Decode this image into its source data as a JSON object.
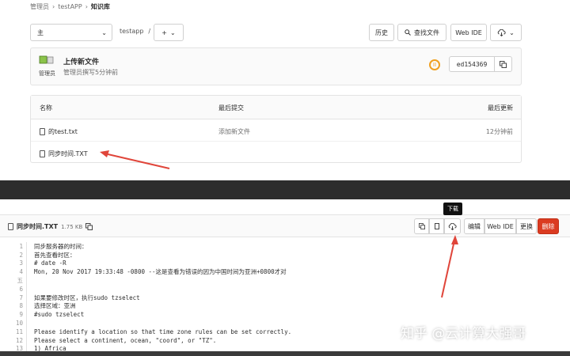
{
  "breadcrumb": [
    "管理员",
    "testAPP",
    "知识库"
  ],
  "toolbar": {
    "branch": "主",
    "path_root": "testapp",
    "path_sep": "/",
    "add_label": "+",
    "history": "历史",
    "find_file": "查找文件",
    "web_ide": "Web IDE"
  },
  "commit": {
    "avatar_text": "管理员",
    "title": "上传新文件",
    "meta": "管理员撰写5分钟前",
    "sha": "ed154369"
  },
  "files": {
    "headers": {
      "name": "名称",
      "last_commit": "最后提交",
      "last_update": "最后更新"
    },
    "rows": [
      {
        "name": "的test.txt",
        "commit": "添加新文件",
        "time": "12分钟前"
      },
      {
        "name": "同步时间.TXT",
        "commit": "",
        "time": ""
      }
    ]
  },
  "tooltip": "下载",
  "viewer": {
    "filename": "同步时间.TXT",
    "size": "1.75 KB",
    "edit": "编辑",
    "web_ide": "Web IDE",
    "replace": "更换",
    "delete": "删除",
    "lines": [
      {
        "n": "1",
        "t": "同步服务器的时间："
      },
      {
        "n": "2",
        "t": "首先查看时区："
      },
      {
        "n": "3",
        "t": "# date -R"
      },
      {
        "n": "4",
        "t": "Mon, 20 Nov 2017 19:33:48 -0800 --这是查看为错误的因为中国时间为亚洲+0800才对"
      },
      {
        "n": "五",
        "t": ""
      },
      {
        "n": "6",
        "t": ""
      },
      {
        "n": "7",
        "t": "如果要修改时区，执行sudo tzselect"
      },
      {
        "n": "8",
        "t": "选择区域：亚洲"
      },
      {
        "n": "9",
        "t": "#sudo tzselect"
      },
      {
        "n": "10",
        "t": ""
      },
      {
        "n": "11",
        "t": "Please identify a location so that time zone rules can be set correctly."
      },
      {
        "n": "12",
        "t": "Please select a continent, ocean, \"coord\", or \"TZ\"."
      },
      {
        "n": "13",
        "t": "1) Africa"
      }
    ]
  },
  "watermark": "知乎 @云计算大强哥",
  "colors": {
    "accent_orange": "#f0a020",
    "danger": "#db3b21",
    "arrow": "#e0453a"
  }
}
